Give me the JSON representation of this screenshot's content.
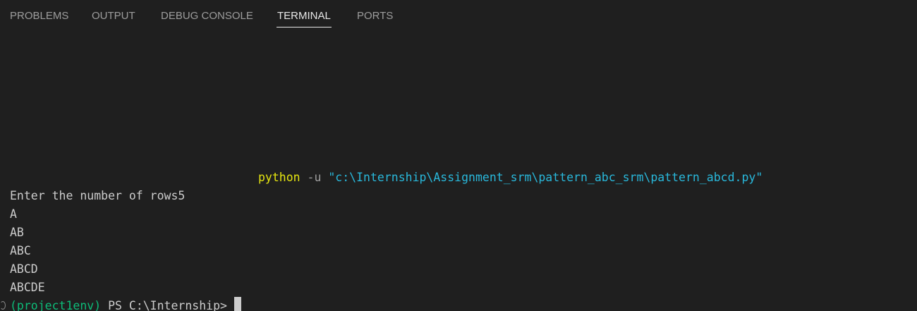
{
  "tabs": [
    {
      "label": "PROBLEMS",
      "active": false
    },
    {
      "label": "OUTPUT",
      "active": false
    },
    {
      "label": "DEBUG CONSOLE",
      "active": false
    },
    {
      "label": "TERMINAL",
      "active": true
    },
    {
      "label": "PORTS",
      "active": false
    }
  ],
  "terminal": {
    "command": {
      "program": "python",
      "flag": "-u",
      "path": "\"c:\\Internship\\Assignment_srm\\pattern_abc_srm\\pattern_abcd.py\""
    },
    "output": [
      "Enter the number of rows5",
      "A",
      "AB",
      "ABC",
      "ABCD",
      "ABCDE"
    ],
    "prompt": {
      "env": "(project1env)",
      "text": "PS C:\\Internship>"
    }
  },
  "colors": {
    "background": "#1f1f1f",
    "text": "#cccccc",
    "python": "#e5e510",
    "path": "#29b8db",
    "env": "#0dbc79",
    "inactive_tab": "#9d9d9d",
    "active_tab": "#e7e7e7"
  }
}
